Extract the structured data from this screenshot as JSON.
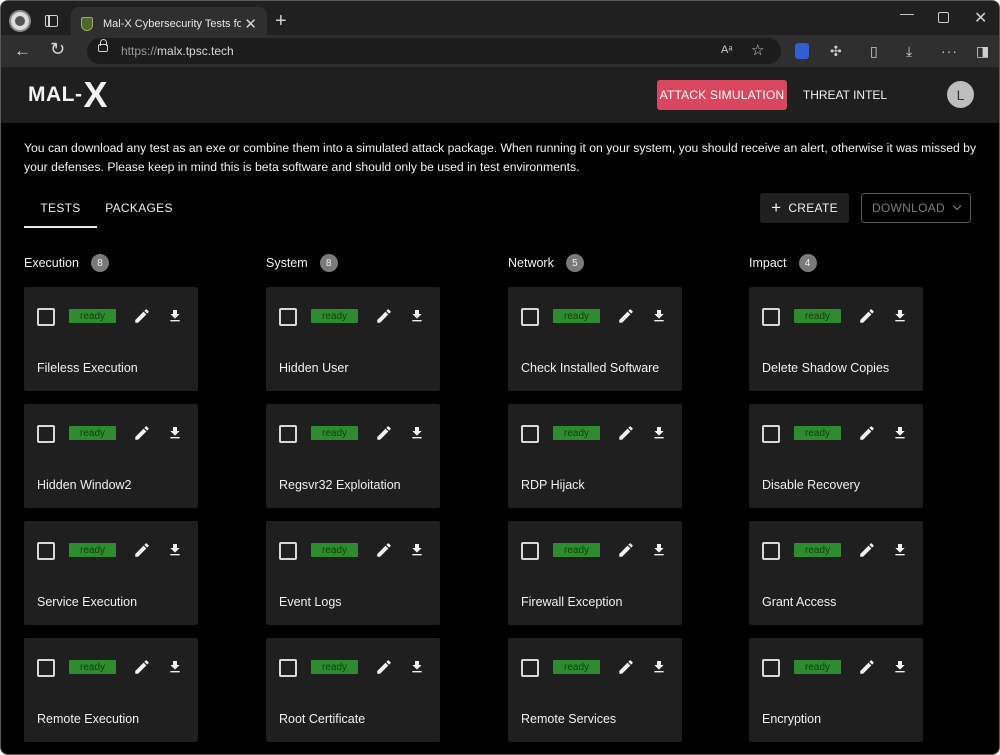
{
  "browser": {
    "tab_title": "Mal-X Cybersecurity Tests for Ent",
    "tab_close": "✕",
    "new_tab": "+",
    "url_protocol": "https://",
    "url_host": "malx.tpsc.tech",
    "read_aloud": "Aᵃ",
    "more": "···"
  },
  "app": {
    "logo_text": "MAL-",
    "logo_x": "X",
    "nav": {
      "attack_simulation": "ATTACK SIMULATION",
      "threat_intel": "THREAT INTEL"
    },
    "avatar_initial": "L",
    "accent_color": "#d9465f",
    "ready_color": "#2e8b2e"
  },
  "intro": "You can download any test as an exe or combine them into a simulated attack package. When running it on your system, you should receive an alert, otherwise it was missed by your defenses. Please keep in mind this is beta software and should only be used in test environments.",
  "tabs": {
    "tests": "TESTS",
    "packages": "PACKAGES"
  },
  "actions": {
    "create": "CREATE",
    "download": "DOWNLOAD"
  },
  "columns": [
    {
      "title": "Execution",
      "count": "8",
      "cards": [
        {
          "status": "ready",
          "name": "Fileless Execution"
        },
        {
          "status": "ready",
          "name": "Hidden Window2"
        },
        {
          "status": "ready",
          "name": "Service Execution"
        },
        {
          "status": "ready",
          "name": "Remote Execution"
        }
      ]
    },
    {
      "title": "System",
      "count": "8",
      "cards": [
        {
          "status": "ready",
          "name": "Hidden User"
        },
        {
          "status": "ready",
          "name": "Regsvr32 Exploitation"
        },
        {
          "status": "ready",
          "name": "Event Logs"
        },
        {
          "status": "ready",
          "name": "Root Certificate"
        }
      ]
    },
    {
      "title": "Network",
      "count": "5",
      "cards": [
        {
          "status": "ready",
          "name": "Check Installed Software"
        },
        {
          "status": "ready",
          "name": "RDP Hijack"
        },
        {
          "status": "ready",
          "name": "Firewall Exception"
        },
        {
          "status": "ready",
          "name": "Remote Services"
        }
      ]
    },
    {
      "title": "Impact",
      "count": "4",
      "cards": [
        {
          "status": "ready",
          "name": "Delete Shadow Copies"
        },
        {
          "status": "ready",
          "name": "Disable Recovery"
        },
        {
          "status": "ready",
          "name": "Grant Access"
        },
        {
          "status": "ready",
          "name": "Encryption"
        }
      ]
    }
  ]
}
